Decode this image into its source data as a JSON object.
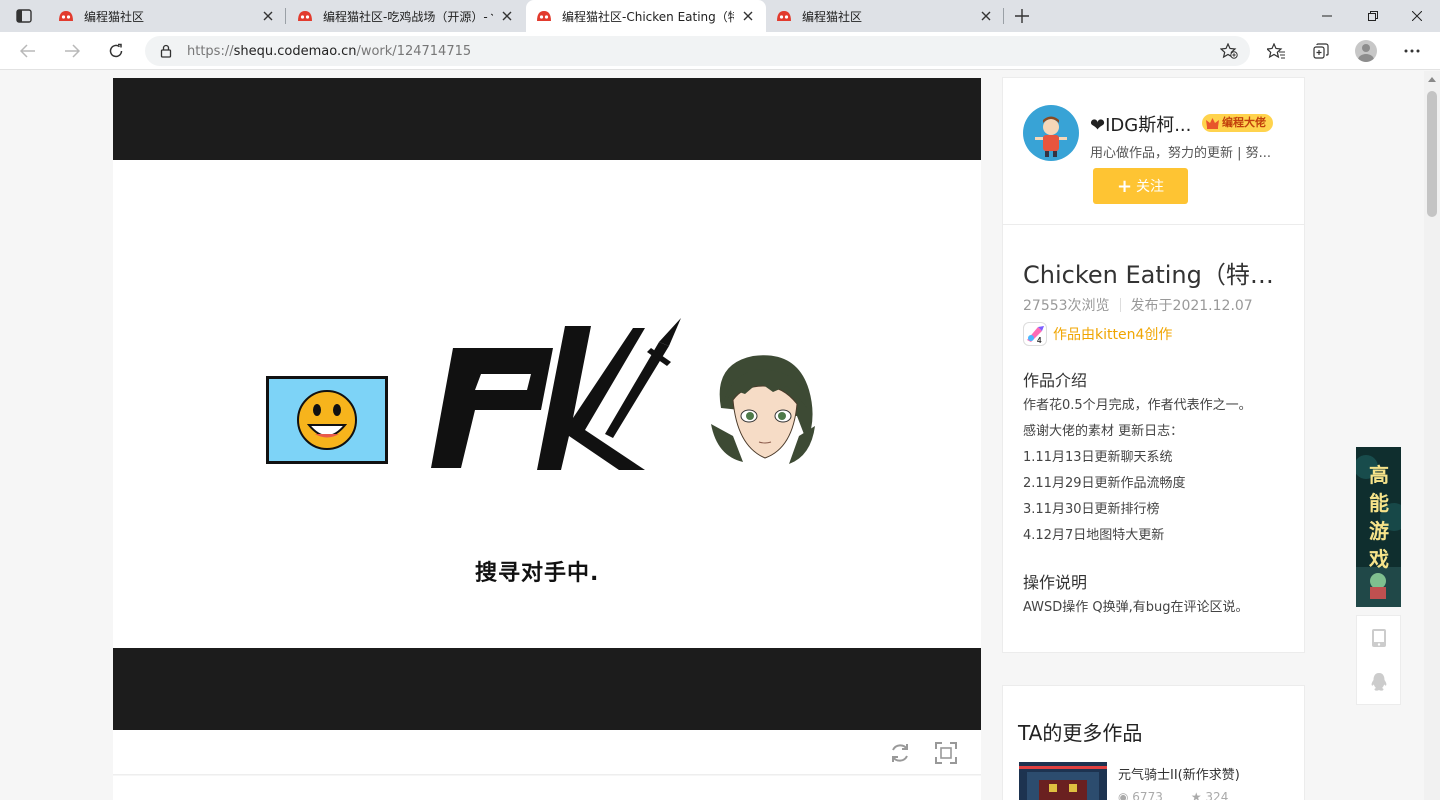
{
  "browser": {
    "tabs": [
      {
        "title": "编程猫社区",
        "active": false
      },
      {
        "title": "编程猫社区-吃鸡战场（开源）-丶",
        "active": false
      },
      {
        "title": "编程猫社区-Chicken Eating（特大",
        "active": true
      },
      {
        "title": "编程猫社区",
        "active": false
      }
    ],
    "url_prefix": "https://",
    "url_host": "shequ.codemao.cn",
    "url_path": "/work/124714715"
  },
  "stage": {
    "searching_text": "搜寻对手中.",
    "pk_label": "PK"
  },
  "author": {
    "name": "❤IDG斯柯...",
    "badge": "编程大佬",
    "bio": "用心做作品，努力的更新 | 努...",
    "follow_label": "关注"
  },
  "work": {
    "title": "Chicken Eating（特大...",
    "views": "27553次浏览",
    "published": "发布于2021.12.07",
    "made_with": "作品由kitten4创作",
    "intro_title": "作品介绍",
    "intro_lines": [
      "作者花0.5个月完成，作者代表作之一。",
      "感谢大佬的素材 更新日志：",
      "1.11月13日更新聊天系统",
      "2.11月29日更新作品流畅度",
      "3.11月30日更新排行榜",
      "4.12月7日地图特大更新"
    ],
    "ops_title": "操作说明",
    "ops_text": "AWSD操作 Q换弹,有bug在评论区说。"
  },
  "more_works": {
    "title": "TA的更多作品",
    "items": [
      {
        "name": "元气骑士II(新作求赞)",
        "views": "6773",
        "likes": "324"
      }
    ]
  },
  "ad": {
    "text": "高能游戏"
  },
  "colors": {
    "accent": "#fec433",
    "badge_bg": "#ffd34d",
    "made_with": "#f0a500",
    "stage_bar": "#1c1c1c"
  }
}
